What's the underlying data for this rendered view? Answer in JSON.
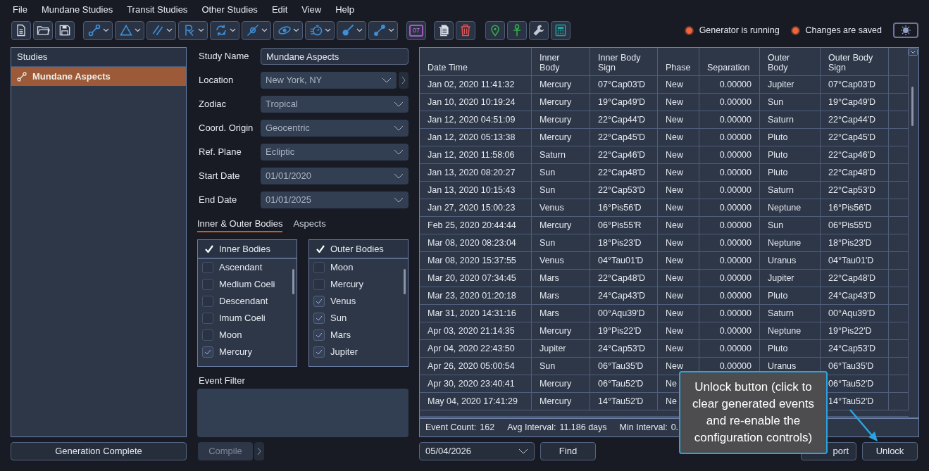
{
  "menu": [
    "File",
    "Mundane Studies",
    "Transit Studies",
    "Other Studies",
    "Edit",
    "View",
    "Help"
  ],
  "toolbar": [
    {
      "kind": "button"
    },
    {
      "kind": "button"
    },
    {
      "kind": "button"
    },
    {
      "kind": "dropdown"
    },
    {
      "kind": "dropdown"
    },
    {
      "kind": "dropdown"
    },
    {
      "kind": "dropdown"
    },
    {
      "kind": "dropdown"
    },
    {
      "kind": "dropdown"
    },
    {
      "kind": "dropdown"
    },
    {
      "kind": "dropdown"
    },
    {
      "kind": "dropdown"
    },
    {
      "kind": "dropdown"
    },
    {
      "kind": "button",
      "label": "07"
    },
    {
      "kind": "button"
    },
    {
      "kind": "button"
    },
    {
      "kind": "button"
    },
    {
      "kind": "button"
    },
    {
      "kind": "button"
    },
    {
      "kind": "button"
    }
  ],
  "status": [
    {
      "label": "Generator is running",
      "on": true
    },
    {
      "label": "Changes are saved",
      "on": true
    }
  ],
  "studies": {
    "title": "Studies",
    "items": [
      {
        "label": "Mundane Aspects",
        "selected": true
      }
    ]
  },
  "form": [
    {
      "label": "Study Name",
      "kind": "text",
      "value": "Mundane Aspects"
    },
    {
      "label": "Location",
      "kind": "select",
      "value": "New York, NY",
      "extra": true
    },
    {
      "label": "Zodiac",
      "kind": "select",
      "value": "Tropical"
    },
    {
      "label": "Coord. Origin",
      "kind": "select",
      "value": "Geocentric"
    },
    {
      "label": "Ref. Plane",
      "kind": "select",
      "value": "Ecliptic"
    },
    {
      "label": "Start Date",
      "kind": "select",
      "value": "01/01/2020"
    },
    {
      "label": "End Date",
      "kind": "select",
      "value": "01/01/2025"
    }
  ],
  "tabs": [
    {
      "label": "Inner & Outer Bodies",
      "selected": true
    },
    {
      "label": "Aspects",
      "selected": false
    }
  ],
  "lists": [
    {
      "title": "Inner Bodies",
      "checked": true,
      "items": [
        {
          "label": "Ascendant",
          "checked": false
        },
        {
          "label": "Medium Coeli",
          "checked": false
        },
        {
          "label": "Descendant",
          "checked": false
        },
        {
          "label": "Imum Coeli",
          "checked": false
        },
        {
          "label": "Moon",
          "checked": false
        },
        {
          "label": "Mercury",
          "checked": true
        }
      ]
    },
    {
      "title": "Outer Bodies",
      "checked": true,
      "items": [
        {
          "label": "Moon",
          "checked": false
        },
        {
          "label": "Mercury",
          "checked": false
        },
        {
          "label": "Venus",
          "checked": true
        },
        {
          "label": "Sun",
          "checked": true
        },
        {
          "label": "Mars",
          "checked": true
        },
        {
          "label": "Jupiter",
          "checked": true
        }
      ]
    }
  ],
  "event_filter": {
    "label": "Event Filter"
  },
  "table": {
    "columns": [
      "Date Time",
      "Inner Body",
      "Inner Body Sign",
      "Phase",
      "Separation",
      "Outer Body",
      "Outer Body Sign"
    ],
    "rows": [
      [
        "Jan 02, 2020 11:41:32",
        "Mercury",
        "07°Cap03'D",
        "New",
        "0.00000",
        "Jupiter",
        "07°Cap03'D"
      ],
      [
        "Jan 10, 2020 10:19:24",
        "Mercury",
        "19°Cap49'D",
        "New",
        "0.00000",
        "Sun",
        "19°Cap49'D"
      ],
      [
        "Jan 12, 2020 04:51:09",
        "Mercury",
        "22°Cap44'D",
        "New",
        "0.00000",
        "Saturn",
        "22°Cap44'D"
      ],
      [
        "Jan 12, 2020 05:13:38",
        "Mercury",
        "22°Cap45'D",
        "New",
        "0.00000",
        "Pluto",
        "22°Cap45'D"
      ],
      [
        "Jan 12, 2020 11:58:06",
        "Saturn",
        "22°Cap46'D",
        "New",
        "0.00000",
        "Pluto",
        "22°Cap46'D"
      ],
      [
        "Jan 13, 2020 08:20:27",
        "Sun",
        "22°Cap48'D",
        "New",
        "0.00000",
        "Pluto",
        "22°Cap48'D"
      ],
      [
        "Jan 13, 2020 10:15:43",
        "Sun",
        "22°Cap53'D",
        "New",
        "0.00000",
        "Saturn",
        "22°Cap53'D"
      ],
      [
        "Jan 27, 2020 15:00:23",
        "Venus",
        "16°Pis56'D",
        "New",
        "0.00000",
        "Neptune",
        "16°Pis56'D"
      ],
      [
        "Feb 25, 2020 20:44:44",
        "Mercury",
        "06°Pis55'R",
        "New",
        "0.00000",
        "Sun",
        "06°Pis55'D"
      ],
      [
        "Mar 08, 2020 08:23:04",
        "Sun",
        "18°Pis23'D",
        "New",
        "0.00000",
        "Neptune",
        "18°Pis23'D"
      ],
      [
        "Mar 08, 2020 15:37:55",
        "Venus",
        "04°Tau01'D",
        "New",
        "0.00000",
        "Uranus",
        "04°Tau01'D"
      ],
      [
        "Mar 20, 2020 07:34:45",
        "Mars",
        "22°Cap48'D",
        "New",
        "0.00000",
        "Jupiter",
        "22°Cap48'D"
      ],
      [
        "Mar 23, 2020 01:20:18",
        "Mars",
        "24°Cap43'D",
        "New",
        "0.00000",
        "Pluto",
        "24°Cap43'D"
      ],
      [
        "Mar 31, 2020 14:31:16",
        "Mars",
        "00°Aqu39'D",
        "New",
        "0.00000",
        "Saturn",
        "00°Aqu39'D"
      ],
      [
        "Apr 03, 2020 21:14:35",
        "Mercury",
        "19°Pis22'D",
        "New",
        "0.00000",
        "Neptune",
        "19°Pis22'D"
      ],
      [
        "Apr 04, 2020 22:43:50",
        "Jupiter",
        "24°Cap53'D",
        "New",
        "0.00000",
        "Pluto",
        "24°Cap53'D"
      ],
      [
        "Apr 26, 2020 05:00:54",
        "Sun",
        "06°Tau35'D",
        "New",
        "0.00000",
        "Uranus",
        "06°Tau35'D"
      ],
      [
        "Apr 30, 2020 23:40:41",
        "Mercury",
        "06°Tau52'D",
        "Ne",
        null,
        null,
        "06°Tau52'D"
      ],
      [
        "May 04, 2020 17:41:29",
        "Mercury",
        "14°Tau52'D",
        "Ne",
        null,
        null,
        "14°Tau52'D"
      ]
    ]
  },
  "stats": [
    {
      "label": "Event Count:",
      "value": "162"
    },
    {
      "label": "Avg Interval:",
      "value": "11.186 days"
    },
    {
      "label": "Min Interval:",
      "value": "0."
    }
  ],
  "generation_button": "Generation Complete",
  "compile_button": {
    "label": "Compile",
    "disabled": true
  },
  "find_date": "05/04/2026",
  "find_button": "Find",
  "export_button": "port",
  "unlock_button": "Unlock",
  "tooltip": "Unlock button (click to clear generated events and re-enable the configuration controls)"
}
